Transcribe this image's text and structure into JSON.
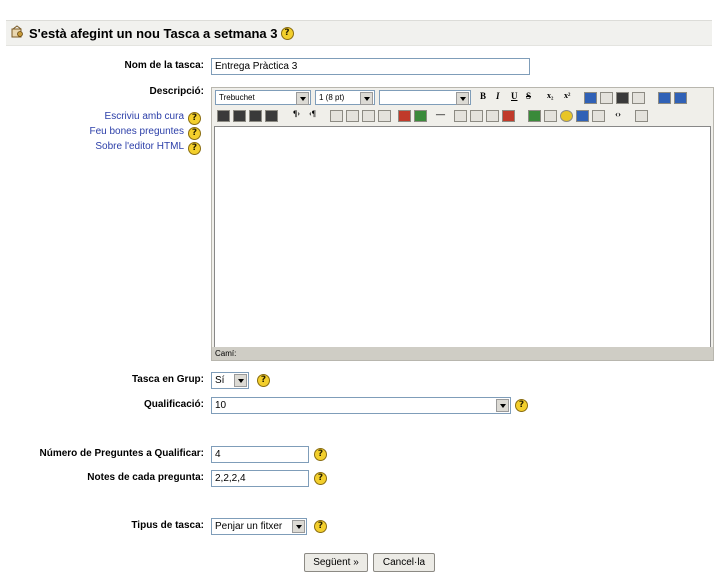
{
  "header": {
    "title": "S'està afegint un nou Tasca a setmana 3"
  },
  "form": {
    "name_label": "Nom de la tasca:",
    "name_value": "Entrega Pràctica 3",
    "description_label": "Descripció:",
    "help_links": [
      "Escriviu amb cura",
      "Feu bones preguntes",
      "Sobre l'editor HTML"
    ],
    "group_label": "Tasca en Grup:",
    "group_value": "Sí",
    "grade_label": "Qualificació:",
    "grade_value": "10",
    "num_questions_label": "Número de Preguntes a Qualificar:",
    "num_questions_value": "4",
    "notes_label": "Notes de cada pregunta:",
    "notes_value": "2,2,2,4",
    "type_label": "Tipus de tasca:",
    "type_value": "Penjar un fitxer"
  },
  "editor": {
    "font_value": "Trebuchet",
    "size_value": "1 (8 pt)",
    "format_value": "",
    "path_label": "Camí:"
  },
  "buttons": {
    "next": "Següent »",
    "cancel": "Cancel·la"
  },
  "help_glyph": "?",
  "colors": {
    "help_icon": "#f3cf2c",
    "header_bg": "#f1f1ee",
    "link": "#2b3ea8"
  }
}
